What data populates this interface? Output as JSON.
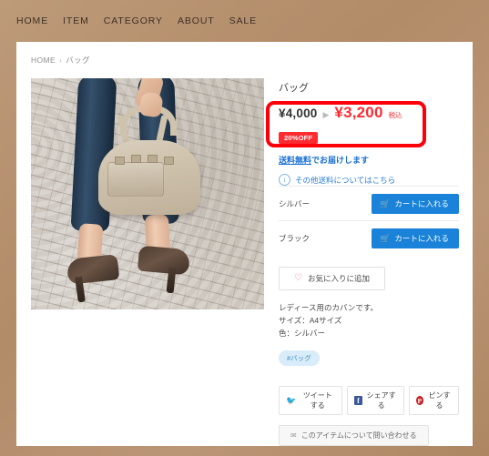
{
  "nav": {
    "items": [
      {
        "label": "HOME",
        "name": "nav-home"
      },
      {
        "label": "ITEM",
        "name": "nav-item"
      },
      {
        "label": "CATEGORY",
        "name": "nav-category"
      },
      {
        "label": "ABOUT",
        "name": "nav-about"
      },
      {
        "label": "SALE",
        "name": "nav-sale"
      }
    ]
  },
  "breadcrumb": {
    "home": "HOME",
    "separator": "›",
    "current": "バッグ"
  },
  "product": {
    "title": "バッグ",
    "price_old": "¥4,000",
    "price_arrow": "▶",
    "price_new": "¥3,200",
    "price_tax_note": "税込",
    "discount_badge": "20%OFF",
    "shipping_free_underline": "送料無料",
    "shipping_free_rest": "でお届けします",
    "shipping_info_icon": "i",
    "shipping_info_link": "その他送料についてはこちら",
    "description_lines": [
      "レディース用のカバンです。",
      "サイズ：A4サイズ",
      "色：シルバー"
    ],
    "tag": "#バッグ",
    "image_alt": "バッグを持つ女性"
  },
  "variants": [
    {
      "name": "シルバー",
      "cart_label": "カートに入れる",
      "cart_icon": "🛒"
    },
    {
      "name": "ブラック",
      "cart_label": "カートに入れる",
      "cart_icon": "🛒"
    }
  ],
  "favorite": {
    "icon": "♡",
    "label": "お気に入りに追加"
  },
  "share": {
    "twitter": {
      "icon": "🐦",
      "label": "ツイートする"
    },
    "facebook": {
      "icon": "f",
      "label": "シェアする"
    },
    "pinterest": {
      "icon": "P",
      "label": "ピンする"
    }
  },
  "contact": {
    "icon": "✉",
    "label": "このアイテムについて問い合わせる"
  },
  "colors": {
    "background": "#b08a68",
    "card": "#ffffff",
    "sale_red": "#ff2a30",
    "annotation_red": "#fb0009",
    "cart_blue": "#1a82d8",
    "link_blue": "#2b7fd6",
    "tag_blue": "#4391c9"
  }
}
